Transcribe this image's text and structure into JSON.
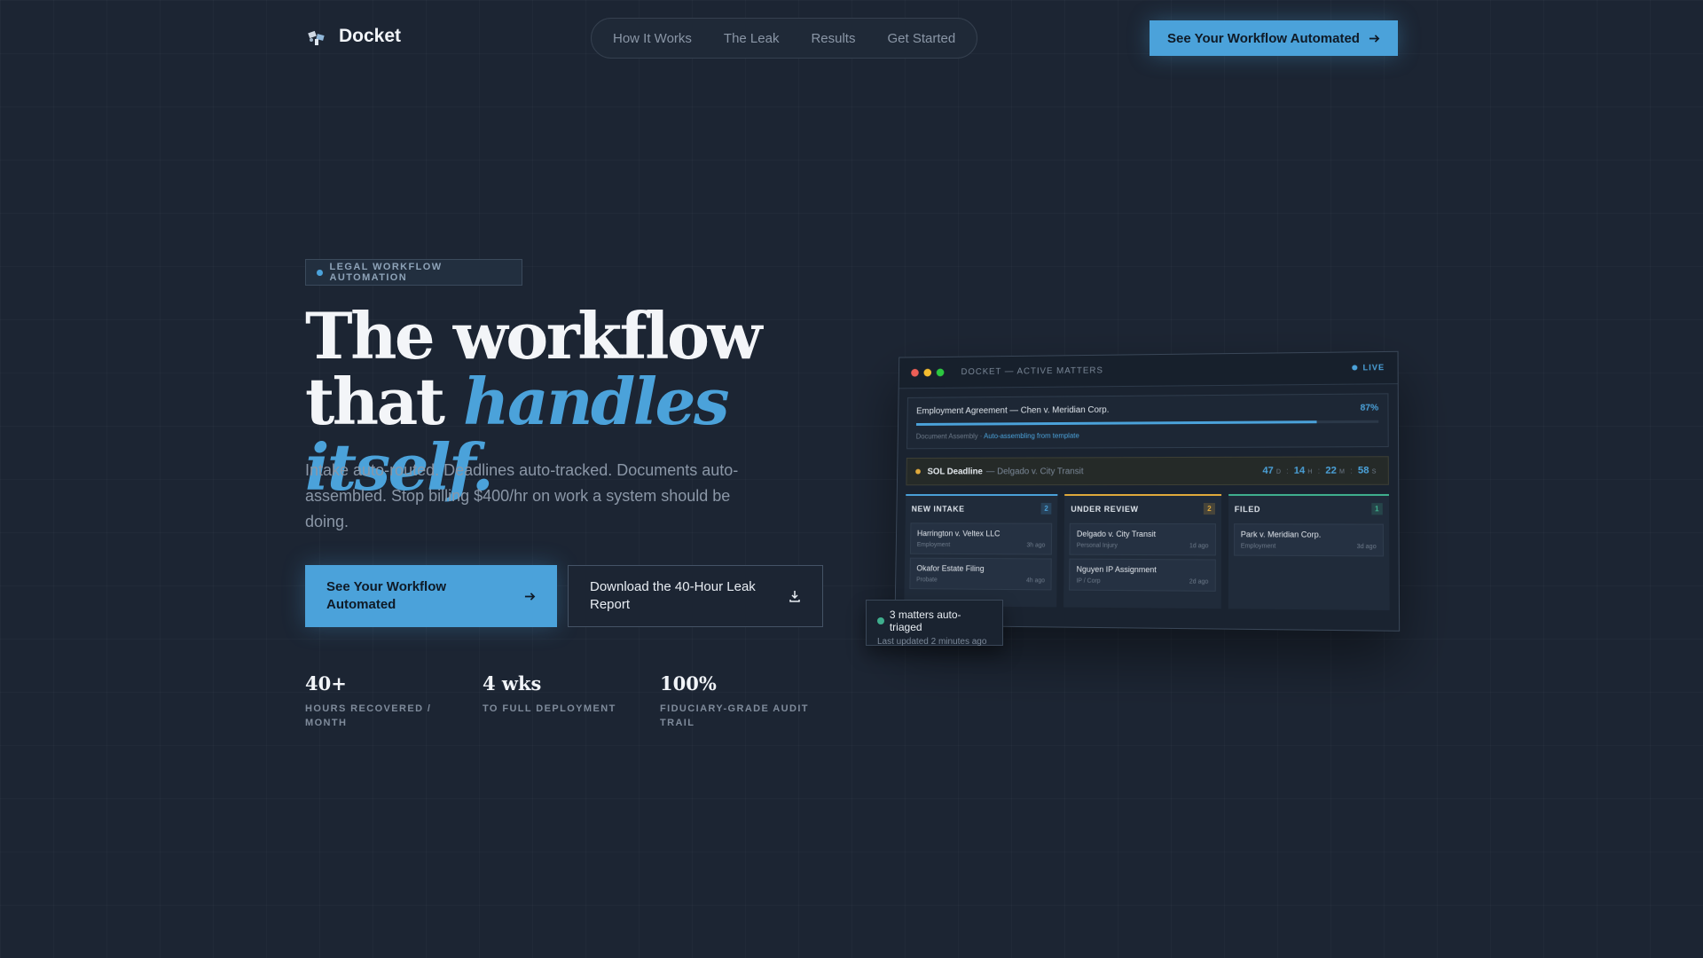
{
  "brand": {
    "name": "Docket"
  },
  "nav": {
    "links": [
      "How It Works",
      "The Leak",
      "Results",
      "Get Started"
    ],
    "cta": "See Your Workflow Automated"
  },
  "hero": {
    "badge": "LEGAL WORKFLOW AUTOMATION",
    "headline_line1": "The workflow",
    "headline_line2_plain": "that ",
    "headline_line2_accent": "handles itself.",
    "subhead": "Intake auto-routed. Deadlines auto-tracked. Documents auto-assembled. Stop billing $400/hr on work a system should be doing.",
    "primary_button": "See Your Workflow Automated",
    "secondary_button": "Download the 40-Hour Leak Report"
  },
  "stats": [
    {
      "value": "40+",
      "label": "HOURS RECOVERED / MONTH"
    },
    {
      "value": "4 wks",
      "label": "TO FULL DEPLOYMENT"
    },
    {
      "value": "100%",
      "label": "FIDUCIARY-GRADE AUDIT TRAIL"
    }
  ],
  "dashboard": {
    "title": "DOCKET — ACTIVE MATTERS",
    "live_label": "LIVE",
    "document": {
      "name": "Employment Agreement — Chen v. Meridian Corp.",
      "percent_label": "87%",
      "progress": 0.87,
      "stage": "Document Assembly",
      "separator": "·",
      "status": "Auto-assembling from template"
    },
    "sol": {
      "title": "SOL Deadline",
      "case": "— Delgado v. City Transit",
      "days": "47",
      "days_unit": "D",
      "hours": "14",
      "hours_unit": "H",
      "minutes": "22",
      "minutes_unit": "M",
      "seconds": "58",
      "seconds_unit": "S",
      "separator": ":"
    },
    "columns": [
      {
        "title": "NEW INTAKE",
        "count": "2",
        "accent": "#4ba2da",
        "cards": [
          {
            "name": "Harrington v. Veltex LLC",
            "type": "Employment",
            "time": "3h ago"
          },
          {
            "name": "Okafor Estate Filing",
            "type": "Probate",
            "time": "4h ago"
          }
        ]
      },
      {
        "title": "UNDER REVIEW",
        "count": "2",
        "accent": "#e0a93b",
        "cards": [
          {
            "name": "Delgado v. City Transit",
            "type": "Personal Injury",
            "time": "1d ago"
          },
          {
            "name": "Nguyen IP Assignment",
            "type": "IP / Corp",
            "time": "2d ago"
          }
        ]
      },
      {
        "title": "FILED",
        "count": "1",
        "accent": "#3fae8d",
        "cards": [
          {
            "name": "Park v. Meridian Corp.",
            "type": "Employment",
            "time": "3d ago"
          }
        ]
      }
    ]
  },
  "toast": {
    "title": "3 matters auto-triaged",
    "subtitle": "Last updated 2 minutes ago"
  },
  "colors": {
    "accent": "#4ba2da",
    "background": "#1c2533",
    "warning": "#e0a93b",
    "success": "#3fae8d"
  }
}
